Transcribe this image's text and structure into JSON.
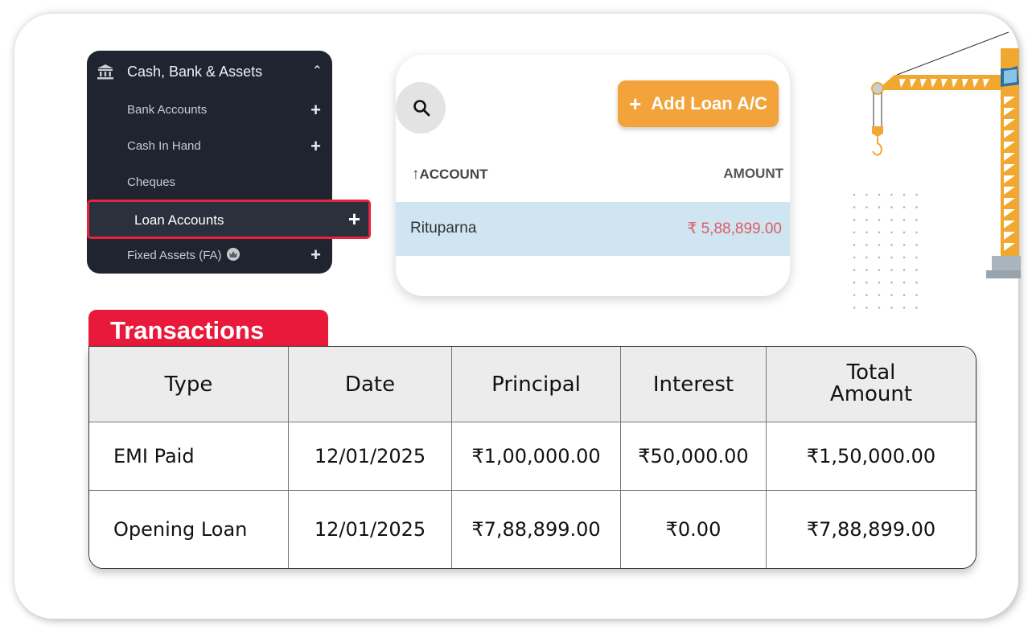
{
  "sidebar": {
    "section_title": "Cash, Bank & Assets",
    "section_icon": "bank-icon",
    "items": [
      {
        "label": "Bank Accounts",
        "has_add": true
      },
      {
        "label": "Cash In Hand",
        "has_add": true
      },
      {
        "label": "Cheques",
        "has_add": false
      },
      {
        "label": "Loan Accounts",
        "has_add": true,
        "highlighted": true
      },
      {
        "label": "Fixed Assets (FA)",
        "has_add": true,
        "badge": "crown-icon"
      }
    ]
  },
  "loan_card": {
    "add_button_label": "Add Loan A/C",
    "columns": {
      "account": "ACCOUNT",
      "amount": "AMOUNT"
    },
    "sort_icon": "arrow-up-icon",
    "rows": [
      {
        "account": "Rituparna",
        "amount": "₹ 5,88,899.00"
      }
    ]
  },
  "transactions": {
    "title": "Transactions",
    "headers": [
      "Type",
      "Date",
      "Principal",
      "Interest",
      "Total Amount"
    ],
    "rows": [
      {
        "type": "EMI Paid",
        "date": "12/01/2025",
        "principal": "₹1,00,000.00",
        "interest": "₹50,000.00",
        "total": "₹1,50,000.00"
      },
      {
        "type": "Opening Loan",
        "date": "12/01/2025",
        "principal": "₹7,88,899.00",
        "interest": "₹0.00",
        "total": "₹7,88,899.00"
      }
    ]
  },
  "colors": {
    "sidebar_bg": "#1f2430",
    "highlight_border": "#e8243c",
    "add_button": "#f2a33a",
    "selected_row": "#cfe5f1",
    "amount_text": "#e05a66",
    "transactions_tab": "#e8193a",
    "crane": "#f0a830"
  }
}
